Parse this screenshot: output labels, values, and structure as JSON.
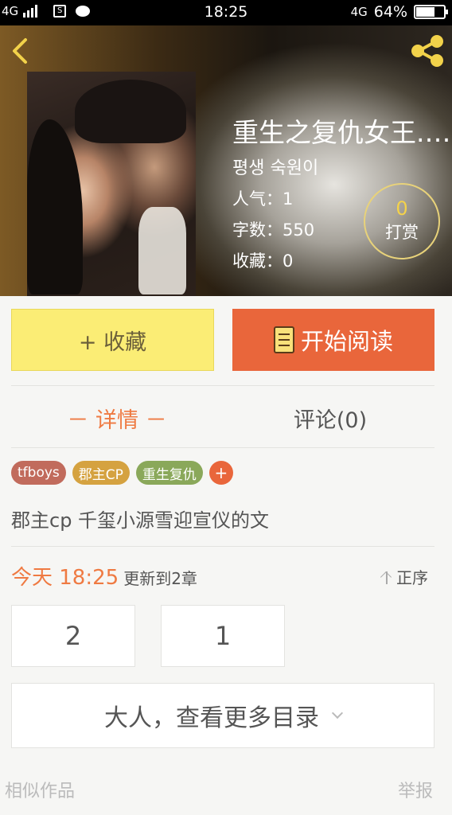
{
  "status_bar": {
    "network_left": "4G",
    "time": "18:25",
    "network_right": "4G",
    "battery": "64%",
    "battery_level": 0.64
  },
  "book": {
    "title": "重生之复仇女王.…",
    "author": "평생 숙원이",
    "popularity": "人气：1",
    "word_count": "字数：550",
    "favorites": "收藏：0",
    "reward_count": "0",
    "reward_label": "打赏"
  },
  "actions": {
    "collect_label": "+ 收藏",
    "read_label": "开始阅读"
  },
  "tabs": {
    "detail": "－ 详情 －",
    "comments": "评论(0)"
  },
  "tags": [
    {
      "label": "tfboys",
      "color": "#c16b5c"
    },
    {
      "label": "郡主CP",
      "color": "#d5a240"
    },
    {
      "label": "重生复仇",
      "color": "#8aa85a"
    }
  ],
  "tag_add": "+",
  "description": "郡主cp  千玺小源雪迎宣仪的文",
  "update": {
    "today": "今天 18:25",
    "text": "更新到2章",
    "sort_label": "正序"
  },
  "chapters": [
    "2",
    "1"
  ],
  "more_label": "大人，查看更多目录",
  "footer": {
    "similar": "相似作品",
    "report": "举报"
  },
  "icons": {
    "back": "chevron-left-icon",
    "share": "share-icon",
    "read": "book-icon"
  },
  "colors": {
    "accent_orange": "#e9663b",
    "collect_yellow": "#fbed75",
    "active_tab": "#ef7a42"
  }
}
